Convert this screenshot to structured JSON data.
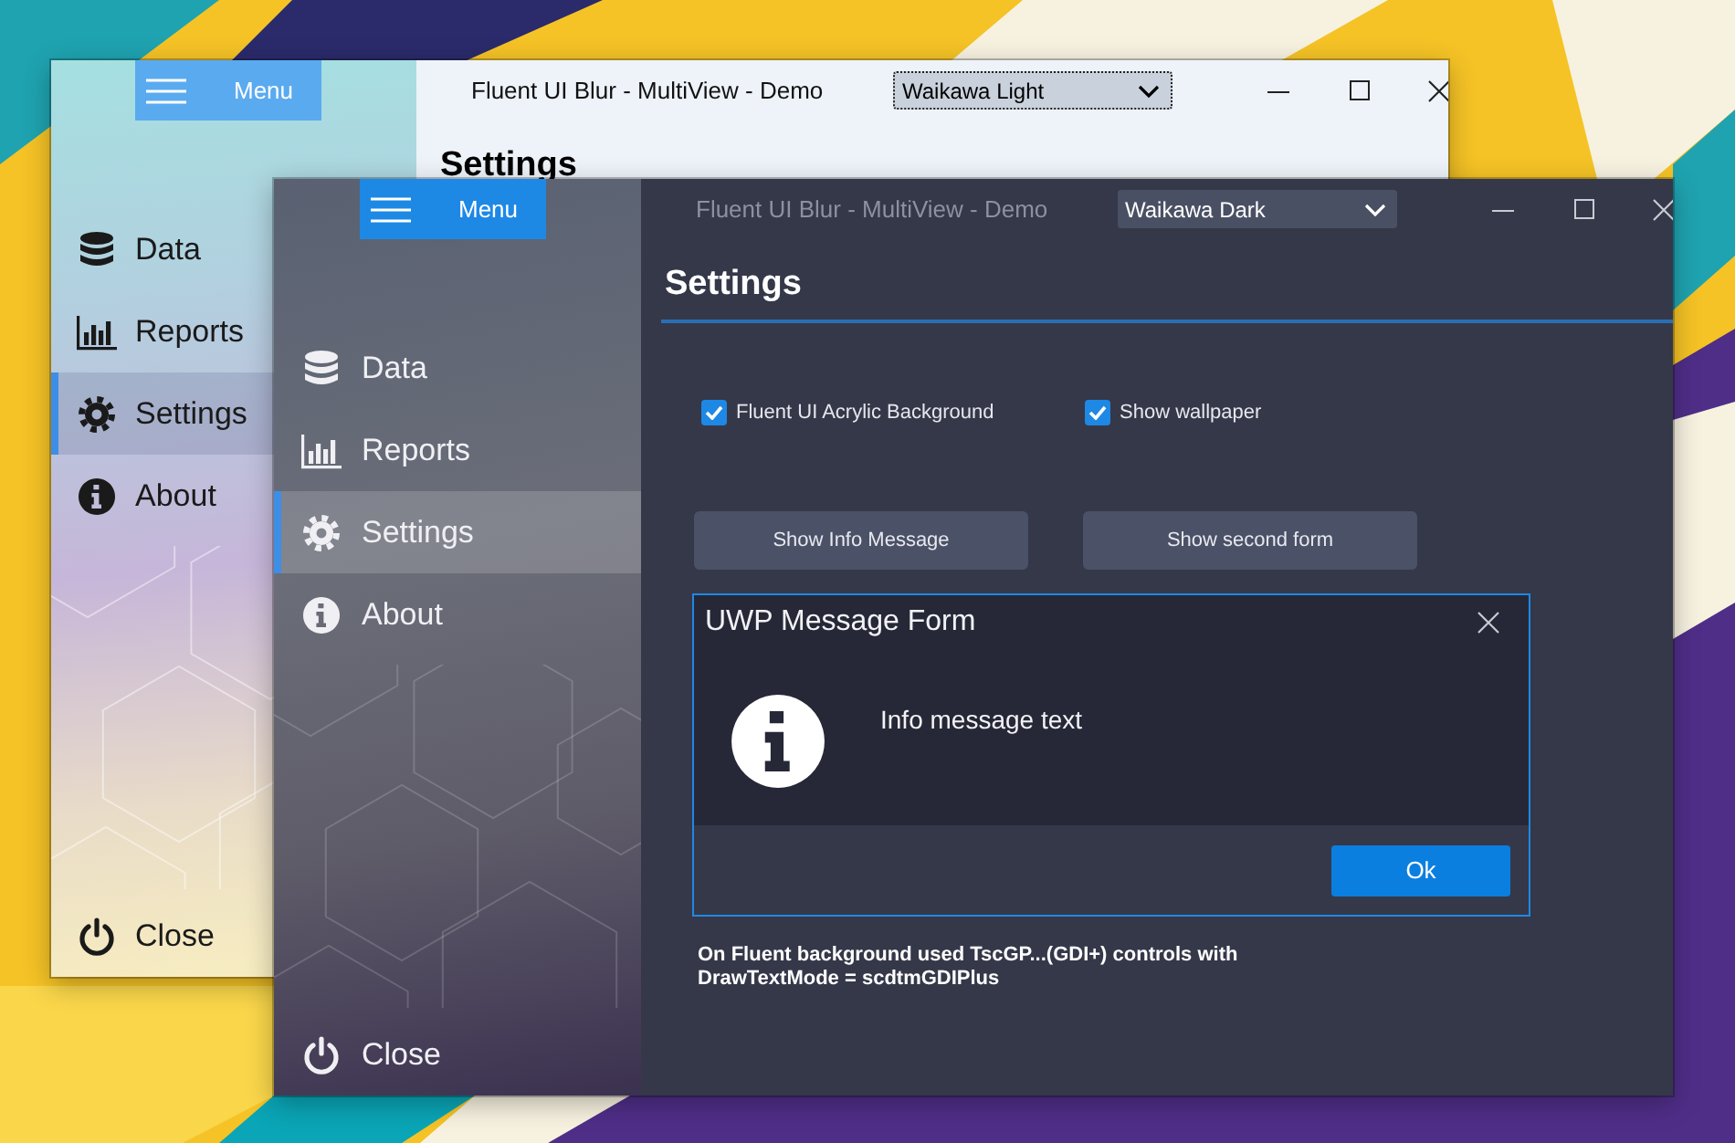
{
  "back_window": {
    "menu_button": "Menu",
    "title": "Fluent UI Blur - MultiView - Demo",
    "theme_select": "Waikawa Light",
    "heading": "Settings",
    "sidebar": {
      "items": [
        {
          "label": "Data",
          "selected": false
        },
        {
          "label": "Reports",
          "selected": false
        },
        {
          "label": "Settings",
          "selected": true
        },
        {
          "label": "About",
          "selected": false
        }
      ],
      "close": "Close"
    }
  },
  "front_window": {
    "menu_button": "Menu",
    "title": "Fluent UI Blur - MultiView - Demo",
    "theme_select": "Waikawa Dark",
    "heading": "Settings",
    "sidebar": {
      "items": [
        {
          "label": "Data",
          "selected": false
        },
        {
          "label": "Reports",
          "selected": false
        },
        {
          "label": "Settings",
          "selected": true
        },
        {
          "label": "About",
          "selected": false
        }
      ],
      "close": "Close"
    },
    "checkboxes": [
      {
        "label": "Fluent UI Acrylic Background",
        "checked": true
      },
      {
        "label": "Show wallpaper",
        "checked": true
      }
    ],
    "buttons": [
      "Show Info Message",
      "Show second form"
    ],
    "note": "On Fluent background used TscGP...(GDI+) controls with\nDrawTextMode = scdtmGDIPlus"
  },
  "dialog": {
    "title": "UWP Message Form",
    "message": "Info message text",
    "button": "Ok"
  }
}
